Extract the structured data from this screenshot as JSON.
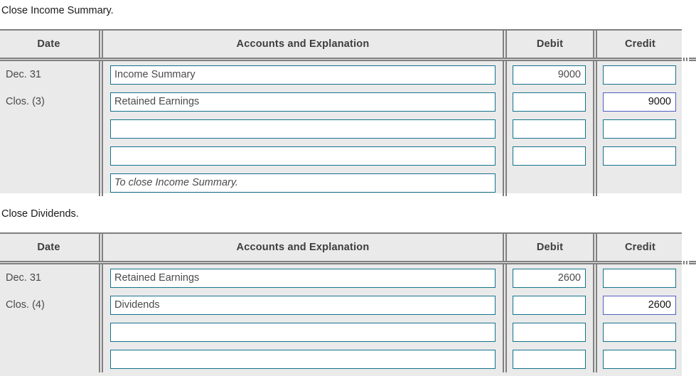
{
  "sections": [
    {
      "title": "Close Income Summary.",
      "columns": {
        "date": "Date",
        "accounts": "Accounts and Explanation",
        "debit": "Debit",
        "credit": "Credit"
      },
      "date_lines": [
        "Dec. 31",
        "Clos. (3)"
      ],
      "rows": [
        {
          "account": "Income Summary",
          "debit": "9000",
          "credit": "",
          "memo": false,
          "focused_field": "none"
        },
        {
          "account": "Retained Earnings",
          "debit": "",
          "credit": "9000",
          "memo": false,
          "focused_field": "credit"
        },
        {
          "account": "",
          "debit": "",
          "credit": "",
          "memo": false,
          "focused_field": "none"
        },
        {
          "account": "",
          "debit": "",
          "credit": "",
          "memo": false,
          "focused_field": "none"
        },
        {
          "account": "To close Income Summary.",
          "debit": null,
          "credit": null,
          "memo": true,
          "focused_field": "none"
        }
      ]
    },
    {
      "title": "Close Dividends.",
      "columns": {
        "date": "Date",
        "accounts": "Accounts and Explanation",
        "debit": "Debit",
        "credit": "Credit"
      },
      "date_lines": [
        "Dec. 31",
        "Clos. (4)"
      ],
      "rows": [
        {
          "account": "Retained Earnings",
          "debit": "2600",
          "credit": "",
          "memo": false,
          "focused_field": "none"
        },
        {
          "account": "Dividends",
          "debit": "",
          "credit": "2600",
          "memo": false,
          "focused_field": "credit"
        },
        {
          "account": "",
          "debit": "",
          "credit": "",
          "memo": false,
          "focused_field": "none"
        },
        {
          "account": "",
          "debit": "",
          "credit": "",
          "memo": false,
          "focused_field": "none"
        }
      ]
    }
  ],
  "colors": {
    "field_border": "#14738c",
    "field_border_focused": "#4f5fc4",
    "table_rule": "#808080",
    "table_background": "#eaeaea",
    "text": "#4a4a4a",
    "header_text": "#3d3d3d"
  }
}
